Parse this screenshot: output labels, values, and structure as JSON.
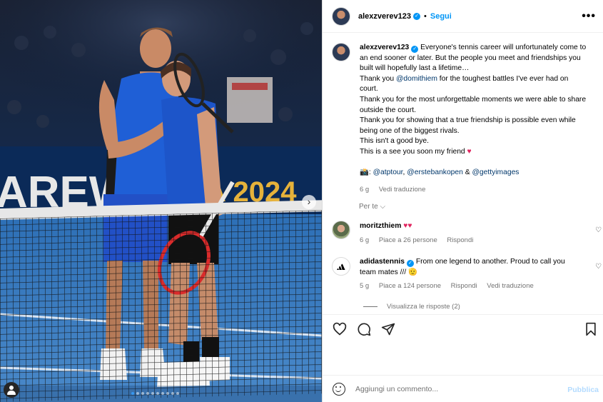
{
  "post": {
    "username": "alexzverev123",
    "follow_label": "Segui",
    "separator": "•",
    "more_label": "•••"
  },
  "caption": {
    "username": "alexzverev123",
    "line1": "Everyone's tennis career will unfortunately come to an end sooner or later. But the people you meet and friendships you built will hopefully last a lifetime…",
    "thanks_prefix": "Thank you",
    "thanks_mention": "@domithiem",
    "thanks_suffix": "for the toughest battles I've ever had on court.",
    "line3": "Thank you for the most unforgettable moments we were able to share outside the court.",
    "line4": "Thank you for showing that a true friendship is possible even while being one of the biggest rivals.",
    "line5": "This isn't a good bye.",
    "line6": "This is a see you soon my friend",
    "heart": "♥",
    "credit_camera": "📸:",
    "credit_mention_1": "@atptour",
    "credit_sep_1": ",",
    "credit_mention_2": "@erstebankopen",
    "credit_sep_2": "&",
    "credit_mention_3": "@gettyimages",
    "time": "6 g",
    "translate": "Vedi traduzione"
  },
  "filter_label": "Per te",
  "comments": [
    {
      "username": "moritzthiem",
      "text": "♥♥",
      "time": "6 g",
      "likes": "Piace a 26 persone",
      "reply": "Rispondi"
    },
    {
      "username": "adidastennis",
      "text": "From one legend to another. Proud to call you team mates /// 🫡",
      "time": "5 g",
      "likes": "Piace a 124 persone",
      "reply": "Rispondi",
      "translate": "Vedi traduzione"
    }
  ],
  "view_replies": "Visualizza le risposte (2)",
  "add_comment": {
    "placeholder": "Aggiungi un commento...",
    "publish": "Pubblica"
  },
  "photo": {
    "banner_text": "AREWE",
    "banner_year": "A 2024",
    "slide_count": 10,
    "active_slide": 1
  },
  "colors": {
    "accent": "#0095f6",
    "mention": "#00376b",
    "heart": "#e0245e",
    "secondary_text": "#737373",
    "publish_disabled": "#b3dbff"
  },
  "icons": [
    "verified-badge-icon",
    "more-options-icon",
    "heart-icon",
    "comment-icon",
    "share-icon",
    "bookmark-icon",
    "emoji-icon",
    "chevron-right-icon",
    "user-tag-icon",
    "chevron-down-icon"
  ]
}
